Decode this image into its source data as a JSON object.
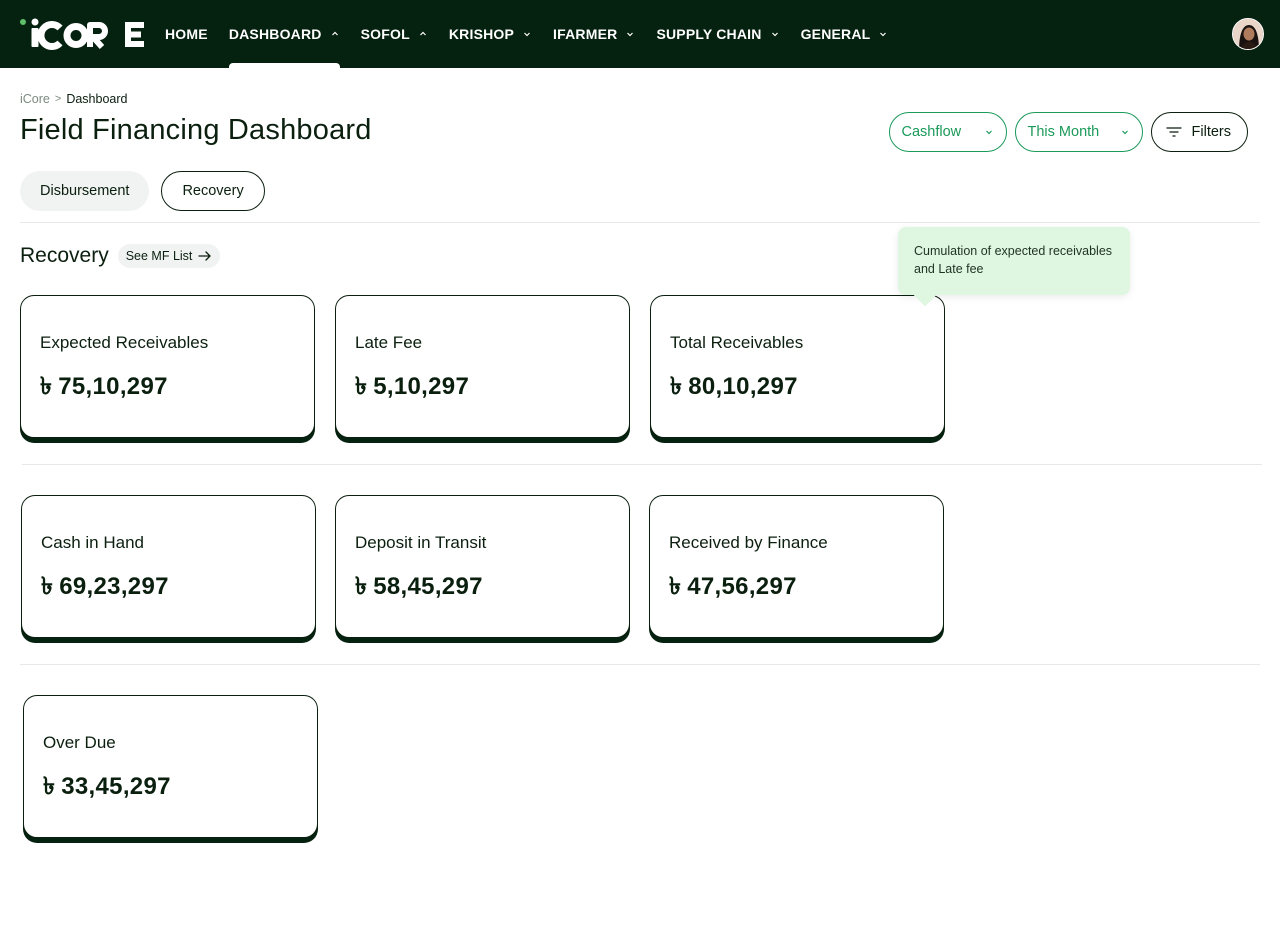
{
  "nav": {
    "logo_text": "iCORE",
    "items": [
      {
        "label": "HOME",
        "has_chevron": false,
        "chevron": "",
        "active": false
      },
      {
        "label": "DASHBOARD",
        "has_chevron": true,
        "chevron": "up",
        "active": true
      },
      {
        "label": "SOFOL",
        "has_chevron": true,
        "chevron": "up",
        "active": false
      },
      {
        "label": "KRISHOP",
        "has_chevron": true,
        "chevron": "down",
        "active": false
      },
      {
        "label": "IFARMER",
        "has_chevron": true,
        "chevron": "down",
        "active": false
      },
      {
        "label": "SUPPLY CHAIN",
        "has_chevron": true,
        "chevron": "down",
        "active": false
      },
      {
        "label": "GENERAL",
        "has_chevron": true,
        "chevron": "down",
        "active": false
      }
    ],
    "avatar_icon": "user-avatar-icon"
  },
  "breadcrumb": {
    "root": "iCore",
    "separator": ">",
    "current": "Dashboard"
  },
  "page_title": "Field Financing Dashboard",
  "controls": {
    "type_select": "Cashflow",
    "period_select": "This Month",
    "filters_label": "Filters"
  },
  "tabs": [
    {
      "label": "Disbursement",
      "active": false
    },
    {
      "label": "Recovery",
      "active": true
    }
  ],
  "section": {
    "title": "Recovery",
    "see_list_label": "See MF List"
  },
  "tooltip": {
    "text": "Cumulation of expected receivables and Late fee"
  },
  "currency_symbol": "৳",
  "cards": [
    {
      "label": "Expected Receivables",
      "value": "75,10,297"
    },
    {
      "label": "Late Fee",
      "value": "5,10,297"
    },
    {
      "label": "Total Receivables",
      "value": "80,10,297"
    },
    {
      "label": "Cash in Hand",
      "value": "69,23,297"
    },
    {
      "label": "Deposit in Transit",
      "value": "58,45,297"
    },
    {
      "label": "Received by Finance",
      "value": "47,56,297"
    },
    {
      "label": "Over Due",
      "value": "33,45,297"
    }
  ],
  "colors": {
    "nav_bg": "#05210f",
    "accent": "#1b9a5a",
    "tooltip_bg": "#dff7e1",
    "card_shadow": "#05210f"
  }
}
